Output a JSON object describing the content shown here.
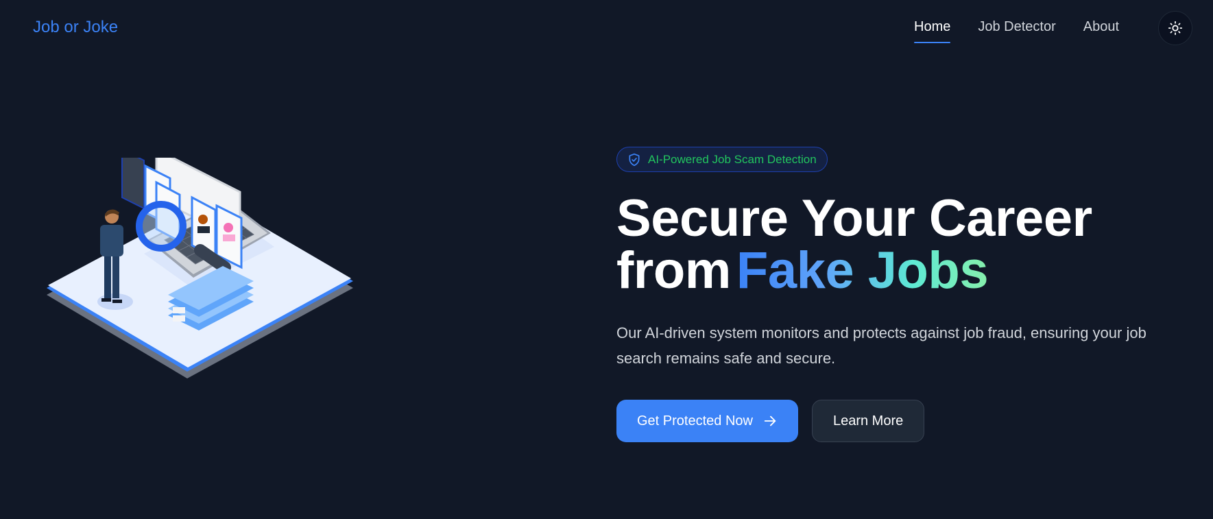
{
  "nav": {
    "brand": "Job or Joke",
    "links": [
      {
        "label": "Home",
        "active": true
      },
      {
        "label": "Job Detector",
        "active": false
      },
      {
        "label": "About",
        "active": false
      }
    ],
    "theme_toggle_icon": "sun-icon"
  },
  "hero": {
    "badge": "AI-Powered Job Scam Detection",
    "badge_icon": "shield-check-icon",
    "headline_line1": "Secure Your Career",
    "headline_from": "from",
    "headline_accent": "Fake Jobs",
    "description": "Our AI-driven system monitors and protects against job fraud, ensuring your job search remains safe and secure.",
    "primary_cta": "Get Protected Now",
    "primary_cta_icon": "arrow-right-icon",
    "secondary_cta": "Learn More"
  },
  "illustration": "isometric-job-search-illustration",
  "colors": {
    "background": "#111827",
    "accent": "#3b82f6",
    "badge_text": "#22c55e",
    "gradient_end": "#86efac"
  }
}
